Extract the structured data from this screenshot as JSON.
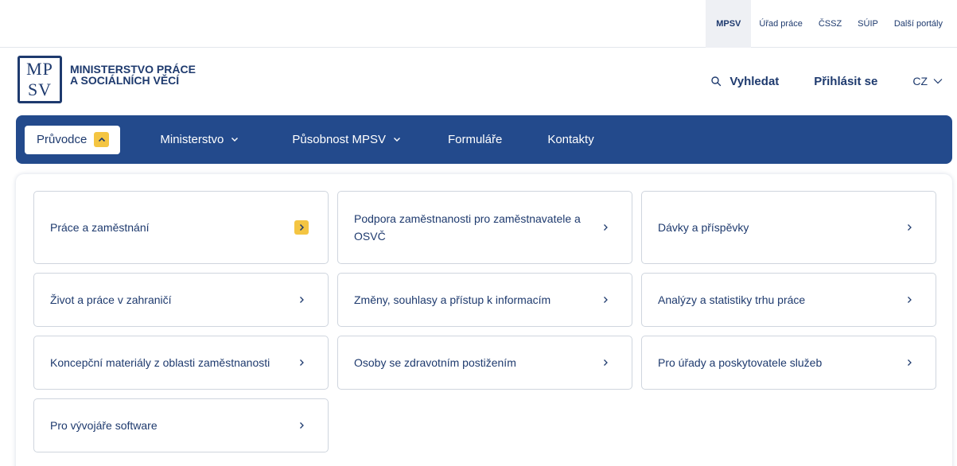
{
  "portal_links": [
    {
      "label": "MPSV",
      "active": true
    },
    {
      "label": "Úřad práce",
      "active": false
    },
    {
      "label": "ČSSZ",
      "active": false
    },
    {
      "label": "SÚIP",
      "active": false
    },
    {
      "label": "Další portály",
      "active": false
    }
  ],
  "logo": {
    "mark_top": "MP",
    "mark_bottom": "SV",
    "line1": "MINISTERSTVO PRÁCE",
    "line2": "A SOCIÁLNÍCH VĚCÍ"
  },
  "header": {
    "search_label": "Vyhledat",
    "login_label": "Přihlásit se",
    "language": "CZ"
  },
  "nav": {
    "guide": "Průvodce",
    "ministry": "Ministerstvo",
    "scope": "Působnost MPSV",
    "forms": "Formuláře",
    "contacts": "Kontakty"
  },
  "submenu": [
    {
      "label": "Práce a zaměstnání",
      "highlighted": true
    },
    {
      "label": "Podpora zaměstnanosti pro zaměstnavatele a OSVČ",
      "highlighted": false
    },
    {
      "label": "Dávky a příspěvky",
      "highlighted": false
    },
    {
      "label": "Život a práce v zahraničí",
      "highlighted": false
    },
    {
      "label": "Změny, souhlasy a přístup k informacím",
      "highlighted": false
    },
    {
      "label": "Analýzy a statistiky trhu práce",
      "highlighted": false
    },
    {
      "label": "Koncepční materiály z oblasti zaměstnanosti",
      "highlighted": false
    },
    {
      "label": "Osoby se zdravotním postižením",
      "highlighted": false
    },
    {
      "label": "Pro úřady a poskytovatele služeb",
      "highlighted": false
    },
    {
      "label": "Pro vývojáře software",
      "highlighted": false
    }
  ],
  "colors": {
    "brand_blue": "#234a8c",
    "text_blue": "#1e3a6e",
    "accent_yellow": "#f4c542"
  }
}
